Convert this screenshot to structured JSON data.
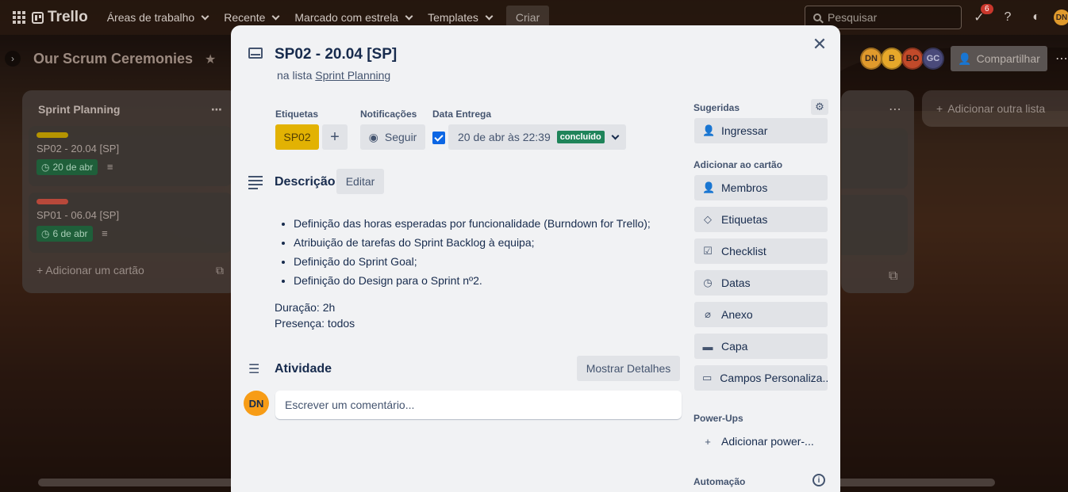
{
  "topbar": {
    "logo": "Trello",
    "nav": [
      "Áreas de trabalho",
      "Recente",
      "Marcado com estrela",
      "Templates"
    ],
    "create_label": "Criar",
    "search_placeholder": "Pesquisar",
    "notification_count": "6",
    "user_initials": "DN"
  },
  "board": {
    "title": "Our Scrum Ceremonies",
    "members": [
      {
        "initials": "DN",
        "color": "#e09a2c"
      },
      {
        "initials": "B",
        "color": "#e6a82a"
      },
      {
        "initials": "BO",
        "color": "#c24a2a"
      },
      {
        "initials": "GC",
        "color": "#4a4a7a"
      }
    ],
    "share_label": "Compartilhar",
    "add_list_label": "Adicionar outra lista"
  },
  "list": {
    "title": "Sprint Planning",
    "cards": [
      {
        "title": "SP02 - 20.04 [SP]",
        "date": "20 de abr",
        "label_color": "#b59400"
      },
      {
        "title": "SP01 - 06.04 [SP]",
        "date": "6 de abr",
        "label_color": "#b8483a"
      }
    ],
    "add_card_label": "Adicionar um cartão"
  },
  "modal": {
    "title": "SP02 - 20.04 [SP]",
    "list_prefix": "na lista",
    "list_name": "Sprint Planning",
    "labels_heading": "Etiquetas",
    "label_chip": "SP02",
    "notifications_heading": "Notificações",
    "follow_label": "Seguir",
    "due_heading": "Data Entrega",
    "due_value": "20 de abr às 22:39",
    "due_status": "concluído",
    "description_heading": "Descrição",
    "edit_label": "Editar",
    "description_items": [
      "Definição das horas esperadas por funcionalidade (Burndown for Trello);",
      "Atribuição de tarefas do Sprint Backlog à equipa;",
      "Definição do Sprint Goal;",
      "Definição do Design para o Sprint nº2."
    ],
    "duration": "Duração: 2h",
    "presence": "Presença: todos",
    "activity_heading": "Atividade",
    "show_details_label": "Mostrar Detalhes",
    "comment_placeholder": "Escrever um comentário...",
    "commenter_initials": "DN"
  },
  "sidebar": {
    "suggested_heading": "Sugeridas",
    "join_label": "Ingressar",
    "add_heading": "Adicionar ao cartão",
    "add_items": [
      "Membros",
      "Etiquetas",
      "Checklist",
      "Datas",
      "Anexo",
      "Capa",
      "Campos Personaliza..."
    ],
    "powerups_heading": "Power-Ups",
    "add_powerup_label": "Adicionar power-...",
    "automation_heading": "Automação"
  }
}
